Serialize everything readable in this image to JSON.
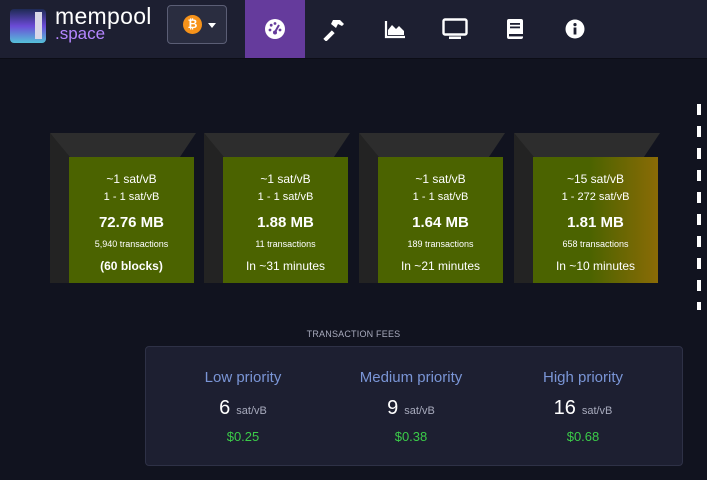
{
  "header": {
    "logo_line1": "mempool",
    "logo_line2": ".space",
    "network_icon": "bitcoin-icon",
    "nav": [
      {
        "icon": "dashboard-gauge-icon",
        "active": true
      },
      {
        "icon": "hammer-icon",
        "active": false
      },
      {
        "icon": "area-chart-icon",
        "active": false
      },
      {
        "icon": "monitor-icon",
        "active": false
      },
      {
        "icon": "book-icon",
        "active": false
      },
      {
        "icon": "info-icon",
        "active": false
      }
    ]
  },
  "blocks": [
    {
      "median_fee": "~1 sat/vB",
      "fee_range": "1 - 1 sat/vB",
      "size": "72.76 MB",
      "tx_count": "5,940 transactions",
      "footer": "(60 blocks)"
    },
    {
      "median_fee": "~1 sat/vB",
      "fee_range": "1 - 1 sat/vB",
      "size": "1.88 MB",
      "tx_count": "11 transactions",
      "footer": "In ~31 minutes"
    },
    {
      "median_fee": "~1 sat/vB",
      "fee_range": "1 - 1 sat/vB",
      "size": "1.64 MB",
      "tx_count": "189 transactions",
      "footer": "In ~21 minutes"
    },
    {
      "median_fee": "~15 sat/vB",
      "fee_range": "1 - 272 sat/vB",
      "size": "1.81 MB",
      "tx_count": "658 transactions",
      "footer": "In ~10 minutes"
    }
  ],
  "fees": {
    "title": "TRANSACTION FEES",
    "unit": "sat/vB",
    "items": [
      {
        "label": "Low priority",
        "rate": "6",
        "usd": "$0.25"
      },
      {
        "label": "Medium priority",
        "rate": "9",
        "usd": "$0.38"
      },
      {
        "label": "High priority",
        "rate": "16",
        "usd": "$0.68"
      }
    ]
  },
  "colors": {
    "accent": "#653b9c",
    "block_face": "#4b6300",
    "block_high_fee": "#8a6b06",
    "fee_usd": "#3bcc49",
    "priority_label": "#7a95d6"
  }
}
